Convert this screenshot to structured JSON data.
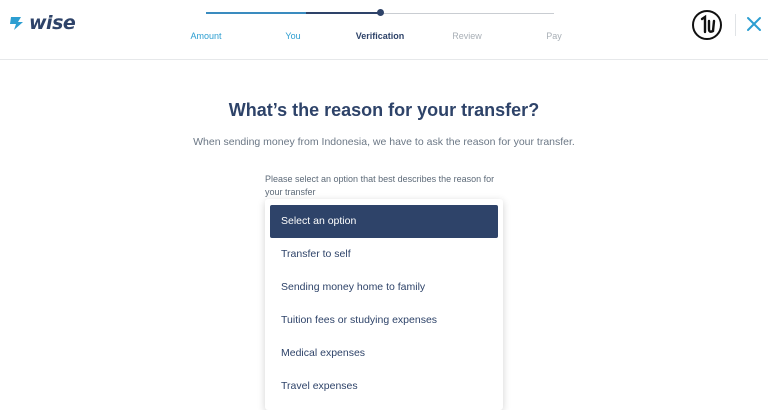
{
  "brand": {
    "logo_text": "wise",
    "accent": "#2c9ed1",
    "navy": "#2e4369"
  },
  "steps": [
    {
      "label": "Amount",
      "state": "done"
    },
    {
      "label": "You",
      "state": "done"
    },
    {
      "label": "Verification",
      "state": "active"
    },
    {
      "label": "Review",
      "state": "todo"
    },
    {
      "label": "Pay",
      "state": "todo"
    }
  ],
  "header": {
    "avatar_icon": "user-avatar-icon",
    "close_icon": "close-icon"
  },
  "main": {
    "title": "What’s the reason for your transfer?",
    "subtitle": "When sending money from Indonesia, we have to ask the reason for your transfer.",
    "prompt": "Please select an option that best describes the reason for your transfer"
  },
  "dropdown": {
    "selected": "Select an option",
    "options": [
      "Select an option",
      "Transfer to self",
      "Sending money home to family",
      "Tuition fees or studying expenses",
      "Medical expenses",
      "Travel expenses"
    ]
  }
}
